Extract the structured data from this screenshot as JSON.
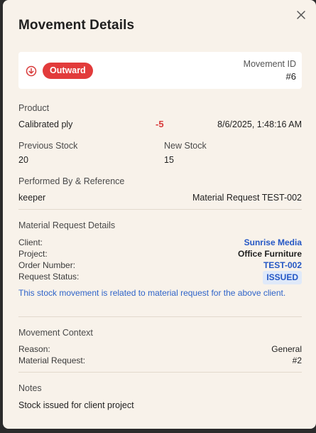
{
  "modal": {
    "title": "Movement Details",
    "close_icon": "close-icon"
  },
  "movement": {
    "direction_icon": "arrow-down-circle-icon",
    "direction": "Outward",
    "id_label": "Movement ID",
    "id_value": "#6"
  },
  "product": {
    "label": "Product",
    "name": "Calibrated ply",
    "quantity": "-5",
    "timestamp": "8/6/2025, 1:48:16 AM"
  },
  "stock": {
    "previous_label": "Previous Stock",
    "previous_value": "20",
    "new_label": "New Stock",
    "new_value": "15"
  },
  "performed": {
    "label": "Performed By & Reference",
    "user": "keeper",
    "reference": "Material Request TEST-002"
  },
  "material_request": {
    "section_title": "Material Request Details",
    "client_label": "Client:",
    "client_value": "Sunrise Media",
    "project_label": "Project:",
    "project_value": "Office Furniture",
    "order_label": "Order Number:",
    "order_value": "TEST-002",
    "status_label": "Request Status:",
    "status_value": "ISSUED",
    "note": "This stock movement is related to material request for the above client."
  },
  "context": {
    "section_title": "Movement Context",
    "reason_label": "Reason:",
    "reason_value": "General",
    "request_label": "Material Request:",
    "request_value": "#2"
  },
  "notes": {
    "section_title": "Notes",
    "text": "Stock issued for client project"
  },
  "colors": {
    "background": "#f8f2ea",
    "outward_badge": "#e23b3b",
    "link_blue": "#2457c5",
    "negative": "#d83a3a"
  }
}
